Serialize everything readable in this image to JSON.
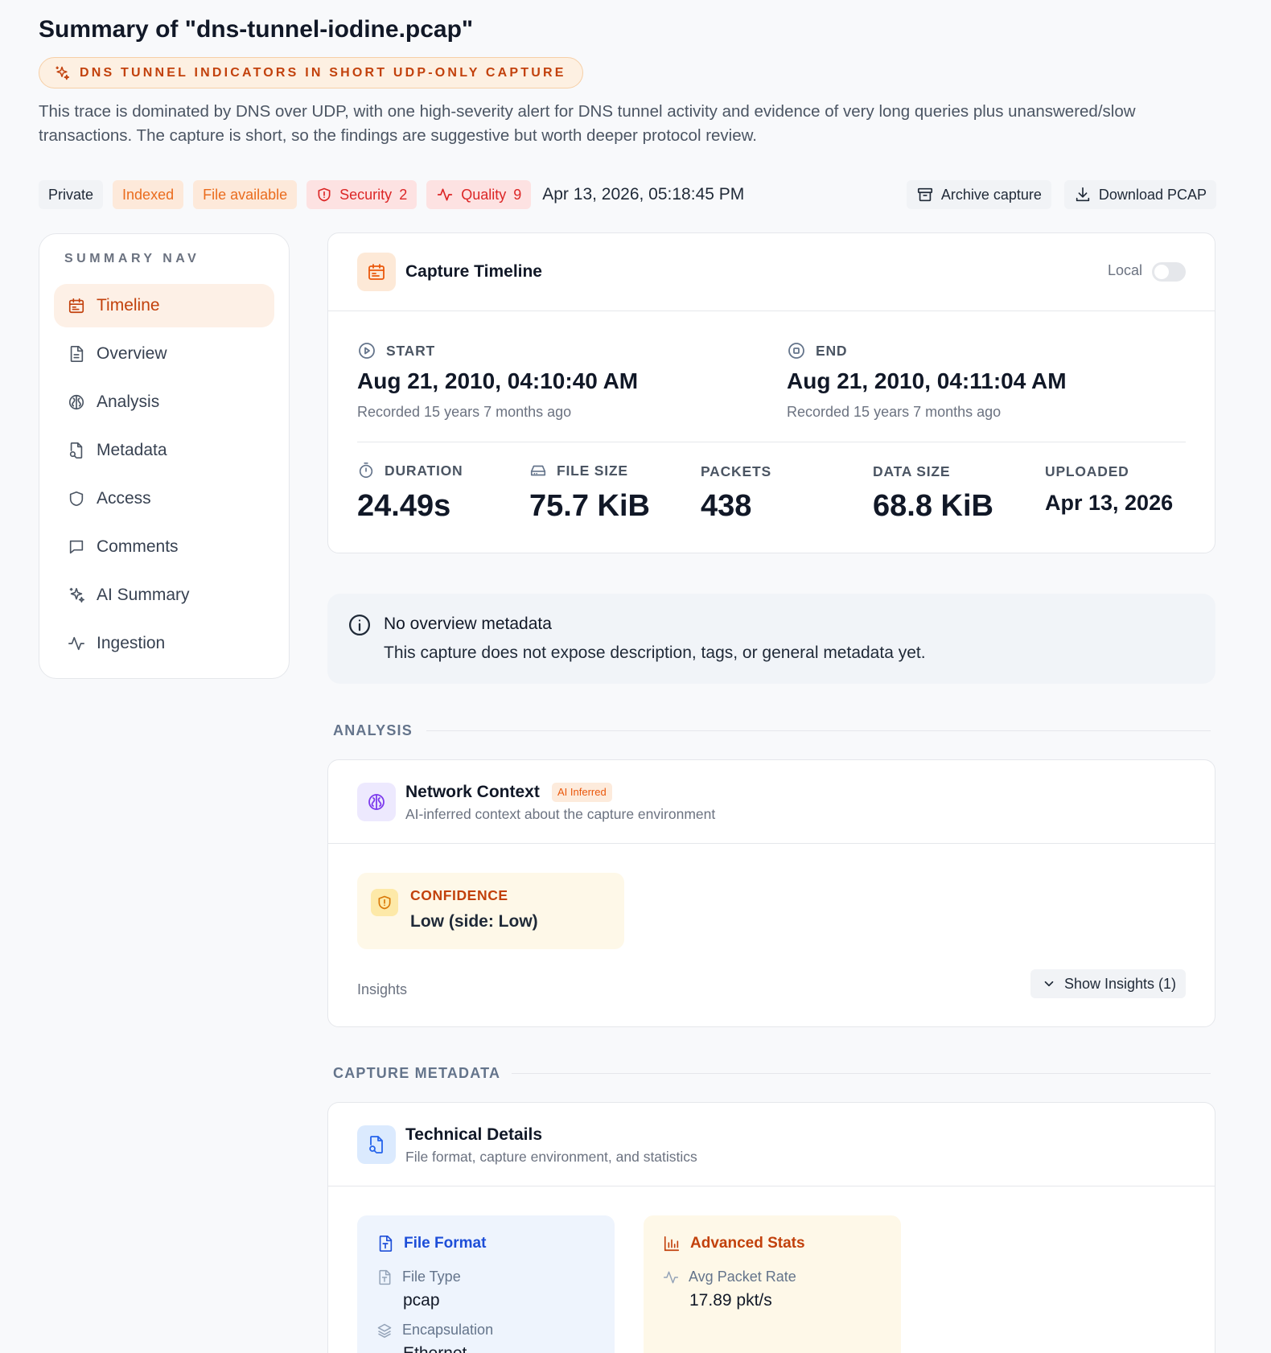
{
  "header": {
    "title": "Summary of \"dns-tunnel-iodine.pcap\"",
    "ai_headline": "DNS TUNNEL INDICATORS IN SHORT UDP-ONLY CAPTURE",
    "summary": "This trace is dominated by DNS over UDP, with one high-severity alert for DNS tunnel activity and evidence of very long queries plus unanswered/slow transactions. The capture is short, so the findings are suggestive but worth deeper protocol review."
  },
  "status": {
    "visibility": "Private",
    "indexed": "Indexed",
    "file_available": "File available",
    "security_label": "Security",
    "security_count": "2",
    "quality_label": "Quality",
    "quality_count": "9",
    "timestamp": "Apr 13, 2026, 05:18:45 PM",
    "archive_label": "Archive capture",
    "download_label": "Download PCAP"
  },
  "sidebar": {
    "heading": "SUMMARY NAV",
    "items": [
      {
        "label": "Timeline",
        "icon": "calendar-icon",
        "active": true
      },
      {
        "label": "Overview",
        "icon": "document-icon"
      },
      {
        "label": "Analysis",
        "icon": "brain-icon"
      },
      {
        "label": "Metadata",
        "icon": "file-search-icon"
      },
      {
        "label": "Access",
        "icon": "shield-icon"
      },
      {
        "label": "Comments",
        "icon": "message-icon"
      },
      {
        "label": "AI Summary",
        "icon": "sparkles-icon"
      },
      {
        "label": "Ingestion",
        "icon": "activity-icon"
      }
    ]
  },
  "timeline": {
    "title": "Capture Timeline",
    "toggle_label": "Local",
    "start_label": "START",
    "start_value": "Aug 21, 2010, 04:10:40 AM",
    "start_relative": "Recorded 15 years 7 months ago",
    "end_label": "END",
    "end_value": "Aug 21, 2010, 04:11:04 AM",
    "end_relative": "Recorded 15 years 7 months ago",
    "stats": {
      "duration_label": "DURATION",
      "duration_value": "24.49s",
      "file_size_label": "FILE SIZE",
      "file_size_value": "75.7 KiB",
      "packets_label": "PACKETS",
      "packets_value": "438",
      "data_size_label": "DATA SIZE",
      "data_size_value": "68.8 KiB",
      "uploaded_label": "UPLOADED",
      "uploaded_value": "Apr 13, 2026"
    }
  },
  "overview": {
    "title": "No overview metadata",
    "message": "This capture does not expose description, tags, or general metadata yet."
  },
  "analysis": {
    "section_label": "ANALYSIS",
    "title": "Network Context",
    "badge": "AI Inferred",
    "subtitle": "AI-inferred context about the capture environment",
    "confidence_label": "CONFIDENCE",
    "confidence_value": "Low (side: Low)",
    "insights_label": "Insights",
    "show_insights_label": "Show Insights (1)"
  },
  "metadata": {
    "section_label": "CAPTURE METADATA",
    "title": "Technical Details",
    "subtitle": "File format, capture environment, and statistics",
    "file_format": {
      "title": "File Format",
      "file_type_label": "File Type",
      "file_type_value": "pcap",
      "encapsulation_label": "Encapsulation",
      "encapsulation_value": "Ethernet"
    },
    "advanced_stats": {
      "title": "Advanced Stats",
      "avg_rate_label": "Avg Packet Rate",
      "avg_rate_value": "17.89 pkt/s"
    }
  },
  "colors": {
    "accent_orange": "#c2410c",
    "security_red": "#dc2626",
    "purple": "#7c3aed",
    "blue": "#1d4ed8"
  }
}
